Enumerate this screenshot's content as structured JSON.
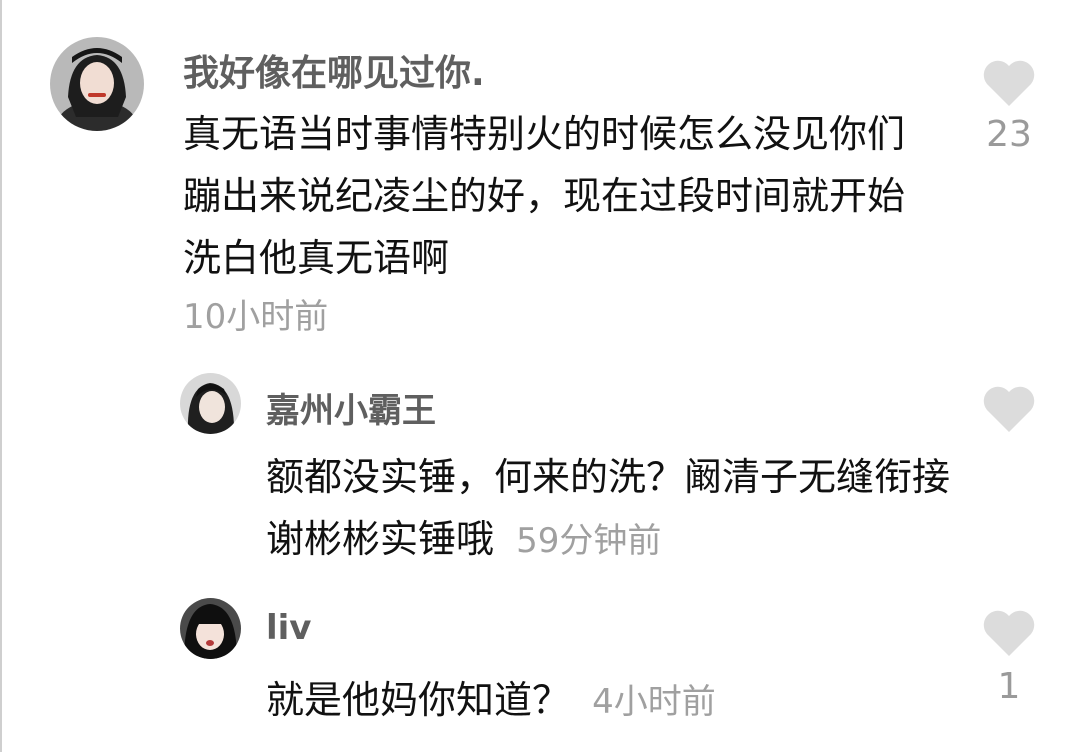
{
  "comments": [
    {
      "username": "我好像在哪见过你.",
      "text": "真无语当时事情特别火的时候怎么没见你们蹦出来说纪凌尘的好，现在过段时间就开始洗白他真无语啊",
      "time": "10小时前",
      "likes": "23"
    }
  ],
  "replies": [
    {
      "username": "嘉州小霸王",
      "text": "额都没实锤，何来的洗？阚清子无缝衔接谢彬彬实锤哦",
      "time": "59分钟前",
      "likes": ""
    },
    {
      "username": "liv",
      "text": "就是他妈你知道？",
      "time": "4小时前",
      "likes": "1"
    }
  ],
  "icons": {
    "like": "heart-icon"
  },
  "colors": {
    "like_icon": "#dcdcdc",
    "username": "#5f5f5f",
    "timestamp": "#a0a0a0"
  }
}
